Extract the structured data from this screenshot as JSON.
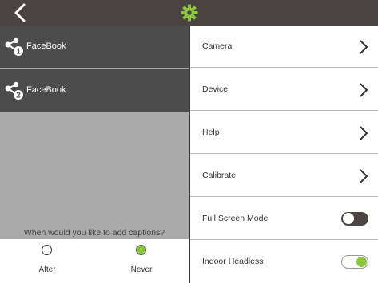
{
  "colors": {
    "topbar": "#4a4543",
    "accent": "#8cc63f",
    "share_row_bg": "#4c4c4c",
    "left_bg": "#aaaaaa"
  },
  "topbar": {
    "back_icon": "chevron-left-icon",
    "settings_icon": "gear-icon"
  },
  "share_targets": [
    {
      "number": "1",
      "label": "FaceBook",
      "icon": "share-icon"
    },
    {
      "number": "2",
      "label": "FaceBook",
      "icon": "share-icon"
    }
  ],
  "captions": {
    "question": "When would you like to add captions?",
    "options": [
      {
        "label": "After",
        "selected": false
      },
      {
        "label": "Never",
        "selected": true
      }
    ]
  },
  "settings": [
    {
      "label": "Camera"
    },
    {
      "label": "Device"
    },
    {
      "label": "Help"
    },
    {
      "label": "Calibrate"
    },
    {
      "label": "Full Screen Mode",
      "toggle": false
    },
    {
      "label": "Indoor Headless",
      "toggle": true
    }
  ]
}
